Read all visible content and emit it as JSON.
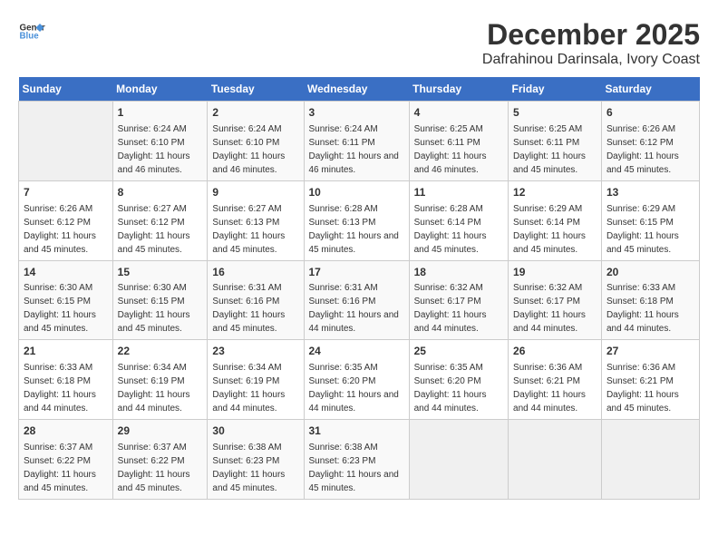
{
  "header": {
    "logo_line1": "General",
    "logo_line2": "Blue",
    "month": "December 2025",
    "location": "Dafrahinou Darinsala, Ivory Coast"
  },
  "weekdays": [
    "Sunday",
    "Monday",
    "Tuesday",
    "Wednesday",
    "Thursday",
    "Friday",
    "Saturday"
  ],
  "weeks": [
    [
      {
        "day": "",
        "info": ""
      },
      {
        "day": "1",
        "info": "Sunrise: 6:24 AM\nSunset: 6:10 PM\nDaylight: 11 hours and 46 minutes."
      },
      {
        "day": "2",
        "info": "Sunrise: 6:24 AM\nSunset: 6:10 PM\nDaylight: 11 hours and 46 minutes."
      },
      {
        "day": "3",
        "info": "Sunrise: 6:24 AM\nSunset: 6:11 PM\nDaylight: 11 hours and 46 minutes."
      },
      {
        "day": "4",
        "info": "Sunrise: 6:25 AM\nSunset: 6:11 PM\nDaylight: 11 hours and 46 minutes."
      },
      {
        "day": "5",
        "info": "Sunrise: 6:25 AM\nSunset: 6:11 PM\nDaylight: 11 hours and 45 minutes."
      },
      {
        "day": "6",
        "info": "Sunrise: 6:26 AM\nSunset: 6:12 PM\nDaylight: 11 hours and 45 minutes."
      }
    ],
    [
      {
        "day": "7",
        "info": "Sunrise: 6:26 AM\nSunset: 6:12 PM\nDaylight: 11 hours and 45 minutes."
      },
      {
        "day": "8",
        "info": "Sunrise: 6:27 AM\nSunset: 6:12 PM\nDaylight: 11 hours and 45 minutes."
      },
      {
        "day": "9",
        "info": "Sunrise: 6:27 AM\nSunset: 6:13 PM\nDaylight: 11 hours and 45 minutes."
      },
      {
        "day": "10",
        "info": "Sunrise: 6:28 AM\nSunset: 6:13 PM\nDaylight: 11 hours and 45 minutes."
      },
      {
        "day": "11",
        "info": "Sunrise: 6:28 AM\nSunset: 6:14 PM\nDaylight: 11 hours and 45 minutes."
      },
      {
        "day": "12",
        "info": "Sunrise: 6:29 AM\nSunset: 6:14 PM\nDaylight: 11 hours and 45 minutes."
      },
      {
        "day": "13",
        "info": "Sunrise: 6:29 AM\nSunset: 6:15 PM\nDaylight: 11 hours and 45 minutes."
      }
    ],
    [
      {
        "day": "14",
        "info": "Sunrise: 6:30 AM\nSunset: 6:15 PM\nDaylight: 11 hours and 45 minutes."
      },
      {
        "day": "15",
        "info": "Sunrise: 6:30 AM\nSunset: 6:15 PM\nDaylight: 11 hours and 45 minutes."
      },
      {
        "day": "16",
        "info": "Sunrise: 6:31 AM\nSunset: 6:16 PM\nDaylight: 11 hours and 45 minutes."
      },
      {
        "day": "17",
        "info": "Sunrise: 6:31 AM\nSunset: 6:16 PM\nDaylight: 11 hours and 44 minutes."
      },
      {
        "day": "18",
        "info": "Sunrise: 6:32 AM\nSunset: 6:17 PM\nDaylight: 11 hours and 44 minutes."
      },
      {
        "day": "19",
        "info": "Sunrise: 6:32 AM\nSunset: 6:17 PM\nDaylight: 11 hours and 44 minutes."
      },
      {
        "day": "20",
        "info": "Sunrise: 6:33 AM\nSunset: 6:18 PM\nDaylight: 11 hours and 44 minutes."
      }
    ],
    [
      {
        "day": "21",
        "info": "Sunrise: 6:33 AM\nSunset: 6:18 PM\nDaylight: 11 hours and 44 minutes."
      },
      {
        "day": "22",
        "info": "Sunrise: 6:34 AM\nSunset: 6:19 PM\nDaylight: 11 hours and 44 minutes."
      },
      {
        "day": "23",
        "info": "Sunrise: 6:34 AM\nSunset: 6:19 PM\nDaylight: 11 hours and 44 minutes."
      },
      {
        "day": "24",
        "info": "Sunrise: 6:35 AM\nSunset: 6:20 PM\nDaylight: 11 hours and 44 minutes."
      },
      {
        "day": "25",
        "info": "Sunrise: 6:35 AM\nSunset: 6:20 PM\nDaylight: 11 hours and 44 minutes."
      },
      {
        "day": "26",
        "info": "Sunrise: 6:36 AM\nSunset: 6:21 PM\nDaylight: 11 hours and 44 minutes."
      },
      {
        "day": "27",
        "info": "Sunrise: 6:36 AM\nSunset: 6:21 PM\nDaylight: 11 hours and 45 minutes."
      }
    ],
    [
      {
        "day": "28",
        "info": "Sunrise: 6:37 AM\nSunset: 6:22 PM\nDaylight: 11 hours and 45 minutes."
      },
      {
        "day": "29",
        "info": "Sunrise: 6:37 AM\nSunset: 6:22 PM\nDaylight: 11 hours and 45 minutes."
      },
      {
        "day": "30",
        "info": "Sunrise: 6:38 AM\nSunset: 6:23 PM\nDaylight: 11 hours and 45 minutes."
      },
      {
        "day": "31",
        "info": "Sunrise: 6:38 AM\nSunset: 6:23 PM\nDaylight: 11 hours and 45 minutes."
      },
      {
        "day": "",
        "info": ""
      },
      {
        "day": "",
        "info": ""
      },
      {
        "day": "",
        "info": ""
      }
    ]
  ]
}
